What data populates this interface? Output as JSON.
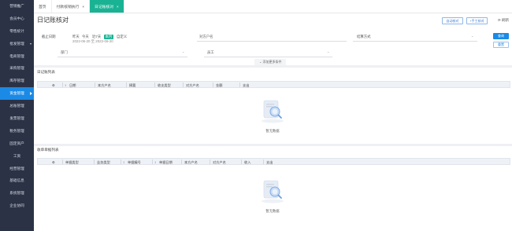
{
  "sidebar": {
    "items": [
      {
        "label": "营销推广"
      },
      {
        "label": "会员中心"
      },
      {
        "label": "零售统计"
      },
      {
        "label": "批发管理",
        "expandable": true
      },
      {
        "label": "电商管理"
      },
      {
        "label": "采购管理"
      },
      {
        "label": "库存管理"
      },
      {
        "label": "资金管理",
        "active": true
      },
      {
        "label": "总账管理"
      },
      {
        "label": "发票管理"
      },
      {
        "label": "税务管理"
      },
      {
        "label": "固定资产"
      },
      {
        "label": "工资"
      },
      {
        "label": "经营管理"
      },
      {
        "label": "基础信息"
      },
      {
        "label": "系统管理"
      },
      {
        "label": "企业协同"
      }
    ]
  },
  "tabs": [
    {
      "label": "首页",
      "closable": false,
      "active": false
    },
    {
      "label": "付款核销执行",
      "closable": true,
      "active": false
    },
    {
      "label": "日记账核对",
      "closable": true,
      "active": true
    }
  ],
  "page": {
    "title": "日记账核对",
    "buttons": {
      "auto_verify": "自动核对",
      "manual_verify": "手工核对",
      "refresh": "刷新"
    }
  },
  "filters": {
    "date_label": "截止日期",
    "date_options": [
      "昨天",
      "今天",
      "近7天",
      "本月",
      "自定义"
    ],
    "date_selected": "本月",
    "date_range": "2022-06-20 至 2022-06-20",
    "account_label": "对方户名",
    "settlement_label": "结算方式",
    "dept_label": "部门",
    "employee_label": "员工",
    "advanced": "添加更多条件"
  },
  "query": {
    "search": "查询",
    "reset": "重置"
  },
  "journal": {
    "title": "日记账列表",
    "columns": [
      "日期",
      "本方户名",
      "摘要",
      "收支类型",
      "对方户名",
      "金额",
      "支出"
    ],
    "empty": "暂无数据"
  },
  "bills": {
    "title": "收单单据列表",
    "columns": [
      "单据类型",
      "业务类型",
      "单据编号",
      "单据日期",
      "本方户名",
      "对方户名",
      "收入",
      "支出"
    ],
    "empty": "暂无数据"
  },
  "colors": {
    "sidebar_bg": "#2b3245",
    "active_menu": "#1a8ae6",
    "active_tab": "#19b394"
  }
}
